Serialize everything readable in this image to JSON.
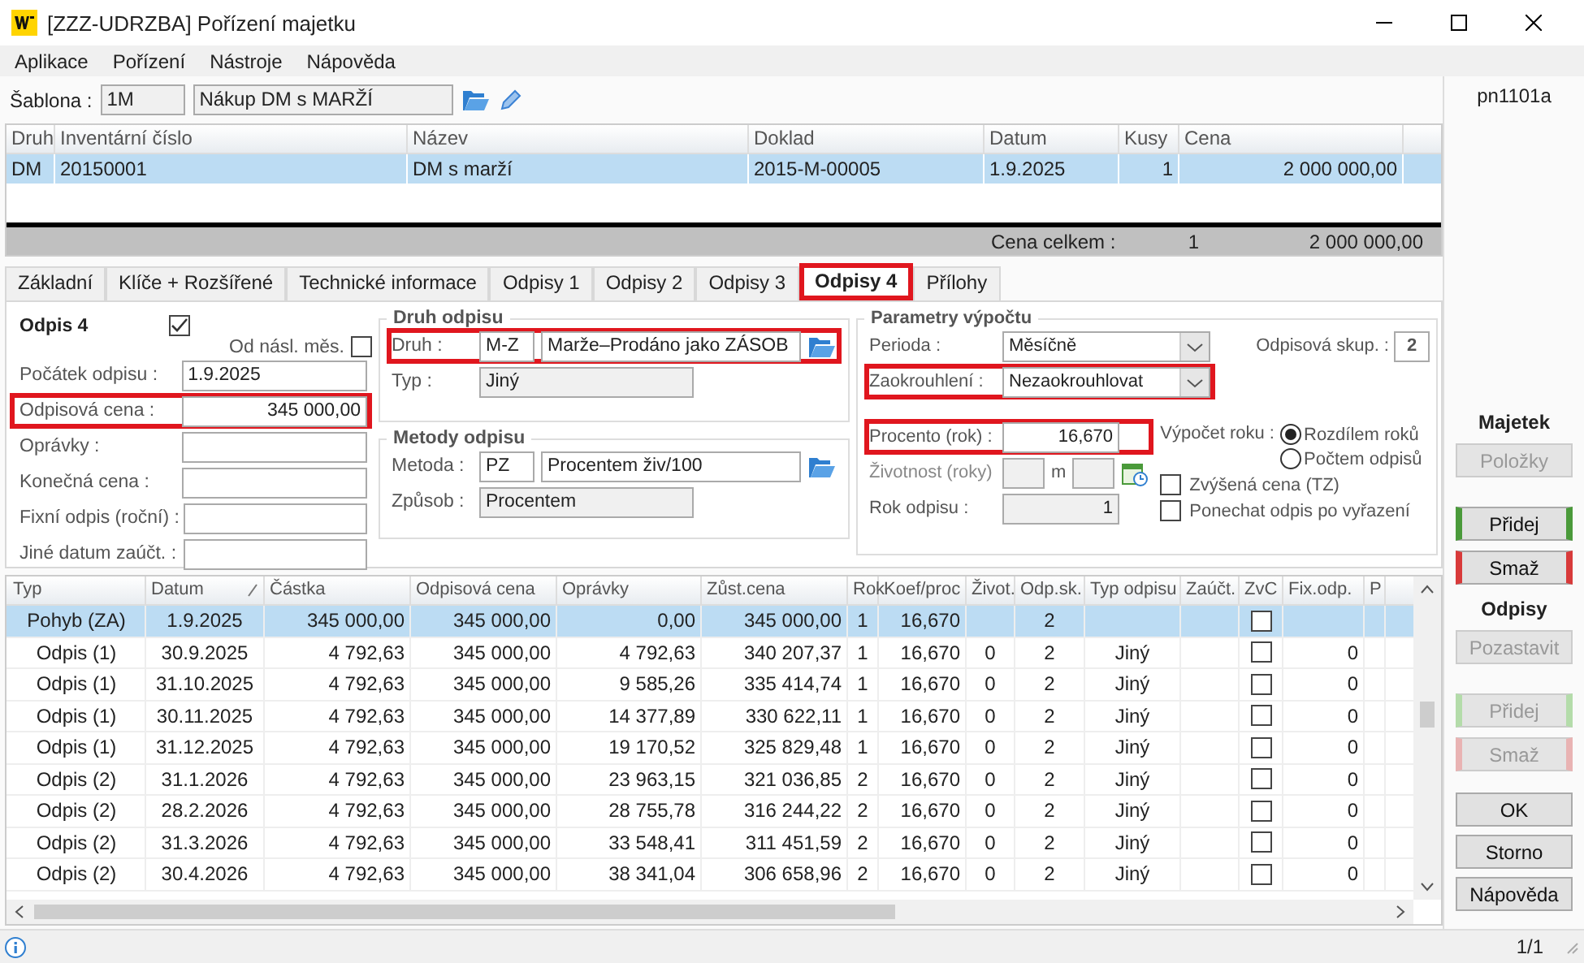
{
  "window": {
    "title": "[ZZZ-UDRZBA] Pořízení majetku"
  },
  "menu": [
    "Aplikace",
    "Pořízení",
    "Nástroje",
    "Nápověda"
  ],
  "template": {
    "label": "Šablona :",
    "code": "1M",
    "name": "Nákup DM s MARŽÍ"
  },
  "form_code": "pn1101a",
  "asset_table": {
    "columns": [
      "Druh",
      "Inventární číslo",
      "Název",
      "Doklad",
      "Datum",
      "Kusy",
      "Cena"
    ],
    "rows": [
      {
        "cells": [
          "DM",
          "20150001",
          "DM s marží",
          "2015-M-00005",
          "1.9.2025",
          "1",
          "2 000 000,00"
        ],
        "selected": true
      }
    ],
    "total": {
      "label": "Cena celkem :",
      "count": "1",
      "price": "2 000 000,00"
    }
  },
  "tabs": [
    {
      "label": "Základní",
      "selected": false,
      "highlighted": false
    },
    {
      "label": "Klíče + Rozšířené",
      "selected": false,
      "highlighted": false
    },
    {
      "label": "Technické informace",
      "selected": false,
      "highlighted": false
    },
    {
      "label": "Odpisy 1",
      "selected": false,
      "highlighted": false
    },
    {
      "label": "Odpisy 2",
      "selected": false,
      "highlighted": false
    },
    {
      "label": "Odpisy 3",
      "selected": false,
      "highlighted": false
    },
    {
      "label": "Odpisy 4",
      "selected": true,
      "highlighted": true
    },
    {
      "label": "Přílohy",
      "selected": false,
      "highlighted": false
    }
  ],
  "depreciation": {
    "title": "Odpis 4",
    "enabled": true,
    "next_month": {
      "label": "Od násl. měs.",
      "checked": false
    },
    "fields": [
      {
        "label": "Počátek odpisu :",
        "value": "1.9.2025",
        "highlighted": false
      },
      {
        "label": "Odpisová cena :",
        "value": "345 000,00",
        "highlighted": true
      },
      {
        "label": "Oprávky :",
        "highlighted": false
      },
      {
        "label": "Konečná cena :",
        "highlighted": false
      },
      {
        "label": "Fixní odpis (roční) :",
        "highlighted": false
      },
      {
        "label": "Jiné datum zaúčt. :",
        "highlighted": false
      }
    ]
  },
  "kind_group": {
    "title": "Druh odpisu",
    "code_row": {
      "label": "Druh :",
      "code": "M-Z",
      "value": "Marže–Prodáno jako ZÁSOB",
      "highlighted": true
    },
    "type_row": {
      "label": "Typ :",
      "value": "Jiný"
    }
  },
  "method_group": {
    "title": "Metody odpisu",
    "code_row": {
      "label": "Metoda :",
      "code": "PZ",
      "value": "Procentem živ/100",
      "highlighted": false
    },
    "type_row": {
      "label": "Způsob :",
      "value": "Procentem"
    }
  },
  "params": {
    "title": "Parametry výpočtu",
    "period": {
      "label": "Perioda :",
      "value": "Měsíčně",
      "highlighted": false
    },
    "rounding": {
      "label": "Zaokrouhlení :",
      "value": "Nezaokrouhlovat",
      "highlighted": true
    },
    "group": {
      "label": "Odpisová skup. :",
      "value": "2"
    },
    "percent": {
      "label": "Procento (rok) :",
      "value": "16,670",
      "highlighted": true
    },
    "life": {
      "label": "Životnost (roky)",
      "unit": "m"
    },
    "year": {
      "label": "Rok odpisu :",
      "value": "1"
    },
    "year_calc": {
      "label": "Výpočet roku :",
      "options": [
        {
          "label": "Rozdílem roků",
          "selected": true
        },
        {
          "label": "Počtem odpisů",
          "selected": false
        }
      ]
    },
    "checks": [
      {
        "label": "Zvýšená cena (TZ)",
        "checked": false
      },
      {
        "label": "Ponechat odpis po vyřazení",
        "checked": false
      }
    ]
  },
  "schedule": {
    "columns": [
      "Typ",
      "Datum",
      "Částka",
      "Odpisová cena",
      "Oprávky",
      "Zůst.cena",
      "Rok",
      "Koef/proc",
      "Život.",
      "Odp.sk.",
      "Typ odpisu",
      "Zaúčt.",
      "ZvC",
      "Fix.odp.",
      "P"
    ],
    "rows": [
      {
        "type": "Pohyb (ZA)",
        "date": "1.9.2025",
        "amount": "345 000,00",
        "base": "345 000,00",
        "accum": "0,00",
        "residual": "345 000,00",
        "year": "1",
        "coef": "16,670",
        "group": "2",
        "zvc": false,
        "selected": true
      },
      {
        "type": "Odpis (1)",
        "date": "30.9.2025",
        "amount": "4 792,63",
        "base": "345 000,00",
        "accum": "4 792,63",
        "residual": "340 207,37",
        "year": "1",
        "coef": "16,670",
        "life": "0",
        "group": "2",
        "kind": "Jiný",
        "zvc": false,
        "fix": "0",
        "selected": false
      },
      {
        "type": "Odpis (1)",
        "date": "31.10.2025",
        "amount": "4 792,63",
        "base": "345 000,00",
        "accum": "9 585,26",
        "residual": "335 414,74",
        "year": "1",
        "coef": "16,670",
        "life": "0",
        "group": "2",
        "kind": "Jiný",
        "zvc": false,
        "fix": "0",
        "selected": false
      },
      {
        "type": "Odpis (1)",
        "date": "30.11.2025",
        "amount": "4 792,63",
        "base": "345 000,00",
        "accum": "14 377,89",
        "residual": "330 622,11",
        "year": "1",
        "coef": "16,670",
        "life": "0",
        "group": "2",
        "kind": "Jiný",
        "zvc": false,
        "fix": "0",
        "selected": false
      },
      {
        "type": "Odpis (1)",
        "date": "31.12.2025",
        "amount": "4 792,63",
        "base": "345 000,00",
        "accum": "19 170,52",
        "residual": "325 829,48",
        "year": "1",
        "coef": "16,670",
        "life": "0",
        "group": "2",
        "kind": "Jiný",
        "zvc": false,
        "fix": "0",
        "selected": false
      },
      {
        "type": "Odpis (2)",
        "date": "31.1.2026",
        "amount": "4 792,63",
        "base": "345 000,00",
        "accum": "23 963,15",
        "residual": "321 036,85",
        "year": "2",
        "coef": "16,670",
        "life": "0",
        "group": "2",
        "kind": "Jiný",
        "zvc": false,
        "fix": "0",
        "selected": false
      },
      {
        "type": "Odpis (2)",
        "date": "28.2.2026",
        "amount": "4 792,63",
        "base": "345 000,00",
        "accum": "28 755,78",
        "residual": "316 244,22",
        "year": "2",
        "coef": "16,670",
        "life": "0",
        "group": "2",
        "kind": "Jiný",
        "zvc": false,
        "fix": "0",
        "selected": false
      },
      {
        "type": "Odpis (2)",
        "date": "31.3.2026",
        "amount": "4 792,63",
        "base": "345 000,00",
        "accum": "33 548,41",
        "residual": "311 451,59",
        "year": "2",
        "coef": "16,670",
        "life": "0",
        "group": "2",
        "kind": "Jiný",
        "zvc": false,
        "fix": "0",
        "selected": false
      },
      {
        "type": "Odpis (2)",
        "date": "30.4.2026",
        "amount": "4 792,63",
        "base": "345 000,00",
        "accum": "38 341,04",
        "residual": "306 658,96",
        "year": "2",
        "coef": "16,670",
        "life": "0",
        "group": "2",
        "kind": "Jiný",
        "zvc": false,
        "fix": "0",
        "selected": false
      }
    ]
  },
  "sidebar": {
    "sections": [
      {
        "title": "Majetek",
        "buttons": [
          {
            "label": "Položky",
            "kind": "plain",
            "disabled": true
          },
          {
            "label": "Přidej",
            "kind": "add",
            "disabled": false
          },
          {
            "label": "Smaž",
            "kind": "delete",
            "disabled": false
          }
        ]
      },
      {
        "title": "Odpisy",
        "buttons": [
          {
            "label": "Pozastavit",
            "kind": "plain",
            "disabled": true
          },
          {
            "label": "Přidej",
            "kind": "add",
            "disabled": true
          },
          {
            "label": "Smaž",
            "kind": "delete",
            "disabled": true
          }
        ]
      }
    ],
    "dialog_buttons": [
      "OK",
      "Storno",
      "Nápověda"
    ]
  },
  "status": {
    "page": "1/1"
  }
}
